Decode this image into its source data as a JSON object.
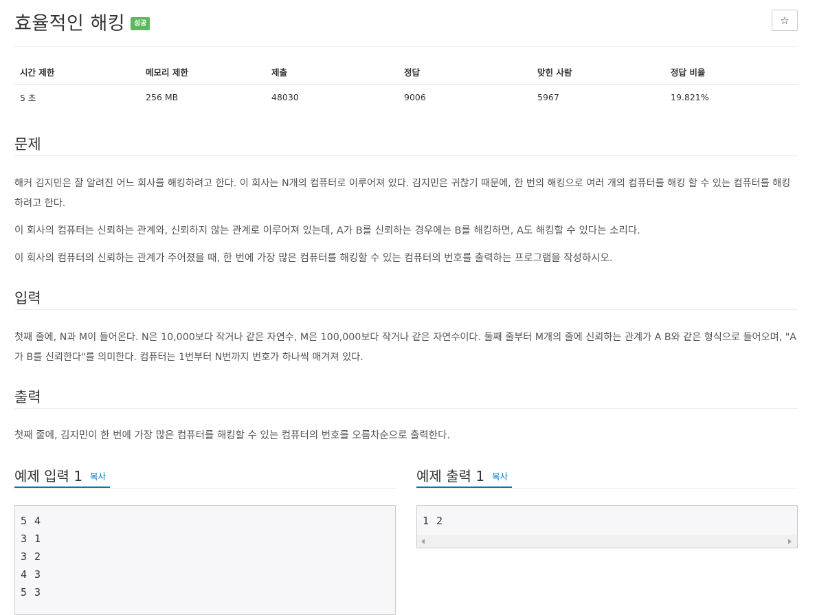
{
  "problem": {
    "title": "효율적인 해킹",
    "badge": "성공",
    "star": "☆"
  },
  "info_table": {
    "headers": [
      "시간 제한",
      "메모리 제한",
      "제출",
      "정답",
      "맞힌 사람",
      "정답 비율"
    ],
    "values": [
      "5 초",
      "256 MB",
      "48030",
      "9006",
      "5967",
      "19.821%"
    ]
  },
  "sections": {
    "problem_heading": "문제",
    "problem_paragraphs": [
      "해커 김지민은 잘 알려진 어느 회사를 해킹하려고 한다. 이 회사는 N개의 컴퓨터로 이루어져 있다. 김지민은 귀찮기 때문에, 한 번의 해킹으로 여러 개의 컴퓨터를 해킹 할 수 있는 컴퓨터를 해킹하려고 한다.",
      "이 회사의 컴퓨터는 신뢰하는 관계와, 신뢰하지 않는 관계로 이루어져 있는데, A가 B를 신뢰하는 경우에는 B를 해킹하면, A도 해킹할 수 있다는 소리다.",
      "이 회사의 컴퓨터의 신뢰하는 관계가 주어졌을 때, 한 번에 가장 많은 컴퓨터를 해킹할 수 있는 컴퓨터의 번호를 출력하는 프로그램을 작성하시오."
    ],
    "input_heading": "입력",
    "input_text": "첫째 줄에, N과 M이 들어온다. N은 10,000보다 작거나 같은 자연수, M은 100,000보다 작거나 같은 자연수이다. 둘째 줄부터 M개의 줄에 신뢰하는 관계가 A B와 같은 형식으로 들어오며, \"A가 B를 신뢰한다\"를 의미한다. 컴퓨터는 1번부터 N번까지 번호가 하나씩 매겨져 있다.",
    "output_heading": "출력",
    "output_text": "첫째 줄에, 김지민이 한 번에 가장 많은 컴퓨터를 해킹할 수 있는 컴퓨터의 번호를 오름차순으로 출력한다."
  },
  "examples": {
    "input_title": "예제 입력 1",
    "output_title": "예제 출력 1",
    "copy_label": "복사",
    "input_lines": [
      "5 4",
      "3 1",
      "3 2",
      "4 3",
      "5 3"
    ],
    "output_lines": [
      "1 2"
    ]
  }
}
